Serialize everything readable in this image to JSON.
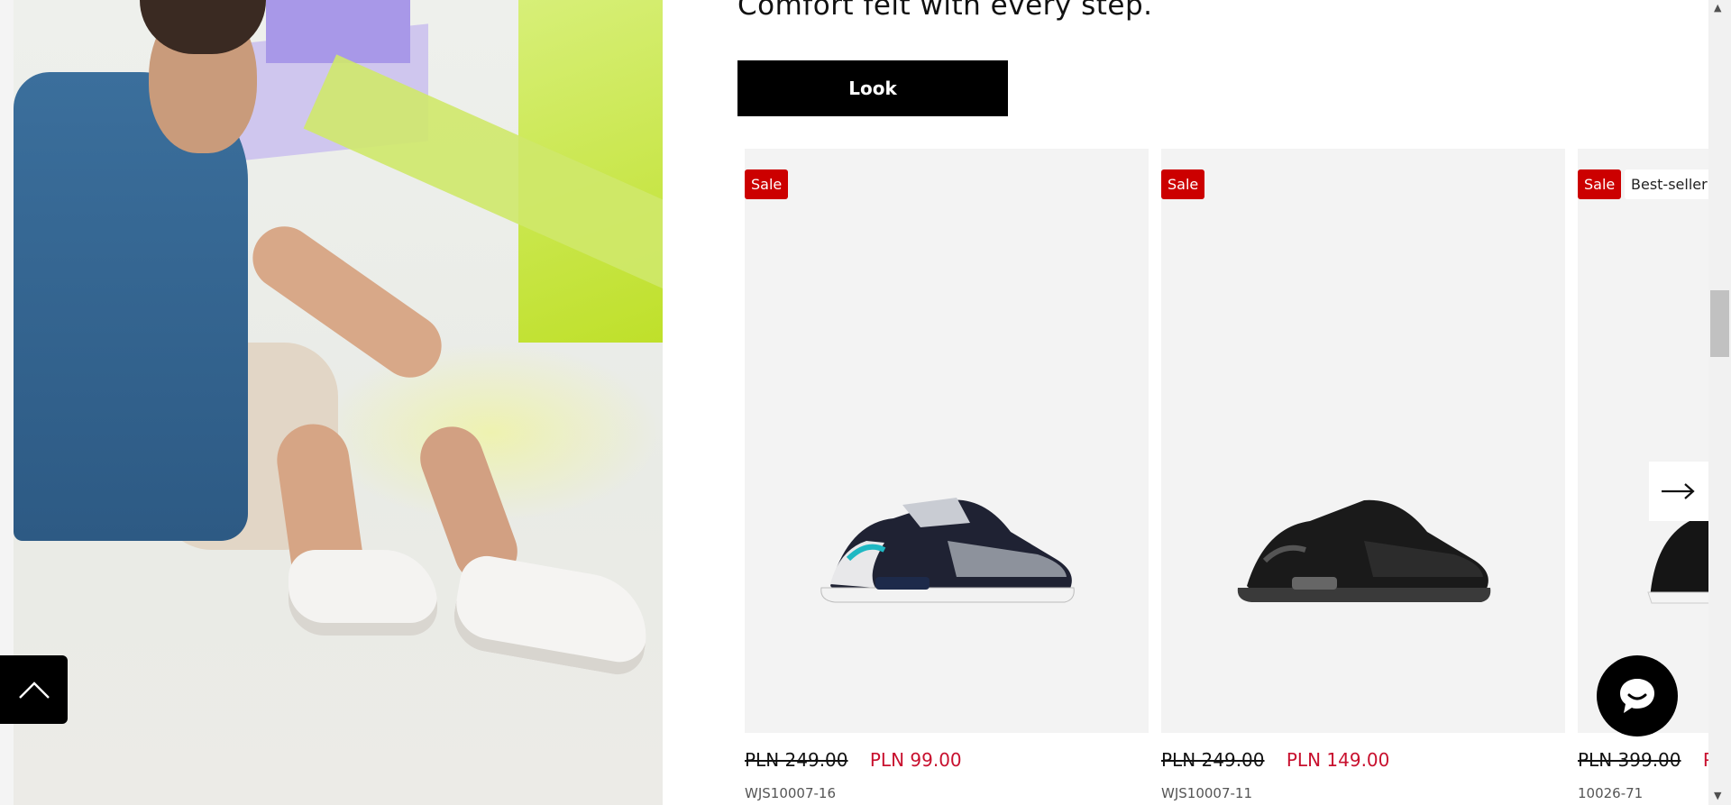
{
  "promo": {
    "tagline": "Comfort felt with every step.",
    "look_button": "Look"
  },
  "products": [
    {
      "badges": [
        "Sale"
      ],
      "old_price": "PLN 249.00",
      "new_price": "PLN 99.00",
      "sku": "WJS10007-16",
      "image": "white-navy-teal-sneaker"
    },
    {
      "badges": [
        "Sale"
      ],
      "old_price": "PLN 249.00",
      "new_price": "PLN 149.00",
      "sku": "WJS10007-11",
      "image": "black-sneaker"
    },
    {
      "badges": [
        "Sale",
        "Best-seller"
      ],
      "old_price": "PLN 399.00",
      "new_price": "PL",
      "sku": "10026-71",
      "image": "black-sneaker-partial"
    }
  ],
  "icons": {
    "next": "arrow-right-icon",
    "chat": "chat-bubble-icon",
    "back_to_top": "chevron-up-icon"
  },
  "colors": {
    "sale_badge": "#cc0000",
    "sale_price": "#c8102e",
    "button": "#000000"
  }
}
